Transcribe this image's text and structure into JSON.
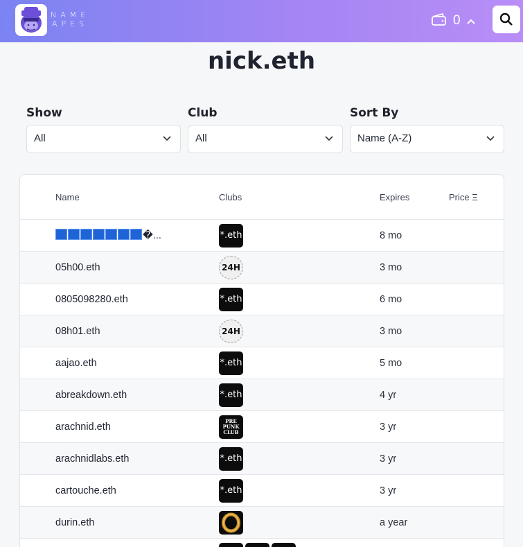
{
  "header": {
    "brand_line1": "NAME",
    "brand_line2": "APES",
    "cart_count": "0",
    "logo_icon": "ape-logo-icon",
    "wallet_icon": "wallet-icon",
    "chevron_icon": "chevron-up-icon",
    "search_icon": "search-icon",
    "gradient_colors": [
      "#7b83f2",
      "#b98df6"
    ]
  },
  "page": {
    "title": "nick.eth"
  },
  "filters": [
    {
      "label": "Show",
      "value": "All"
    },
    {
      "label": "Club",
      "value": "All"
    },
    {
      "label": "Sort By",
      "value": "Name (A-Z)"
    }
  ],
  "table": {
    "columns": [
      "Name",
      "Clubs",
      "Expires",
      "Price Ξ"
    ],
    "rows": [
      {
        "name": "�...",
        "clubs": [
          "*.eth"
        ],
        "expires": "8 mo"
      },
      {
        "name": "05h00.eth",
        "clubs": [
          "24H"
        ],
        "expires": "3 mo"
      },
      {
        "name": "0805098280.eth",
        "clubs": [
          "*.eth"
        ],
        "expires": "6 mo"
      },
      {
        "name": "08h01.eth",
        "clubs": [
          "24H"
        ],
        "expires": "3 mo"
      },
      {
        "name": "aajao.eth",
        "clubs": [
          "*.eth"
        ],
        "expires": "5 mo"
      },
      {
        "name": "abreakdown.eth",
        "clubs": [
          "*.eth"
        ],
        "expires": "4 yr"
      },
      {
        "name": "arachnid.eth",
        "clubs": [
          "PRE PUNK CLUB"
        ],
        "expires": "3 yr"
      },
      {
        "name": "arachnidlabs.eth",
        "clubs": [
          "*.eth"
        ],
        "expires": "3 yr"
      },
      {
        "name": "cartouche.eth",
        "clubs": [
          "*.eth"
        ],
        "expires": "3 yr"
      },
      {
        "name": "durin.eth",
        "clubs": [
          "ring-icon"
        ],
        "expires": "a year"
      }
    ]
  }
}
